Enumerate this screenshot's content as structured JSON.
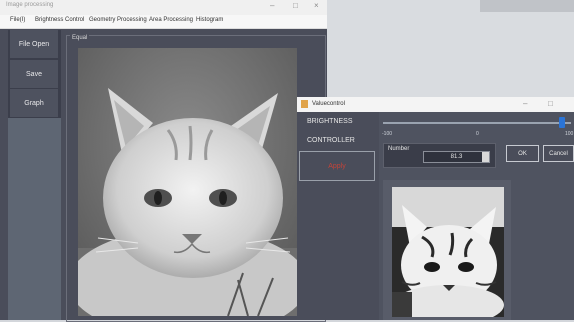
{
  "main_window": {
    "title": "Image processing",
    "menu": [
      "File(I)",
      "Brightness Control",
      "Geometry Processing",
      "Area Processing",
      "Histogram"
    ],
    "sidebar": [
      "File Open",
      "Save",
      "Graph"
    ],
    "frame_label": "Equal"
  },
  "value_control": {
    "title": "Valuecontrol",
    "left_label_1": "BRIGHTNESS",
    "left_label_2": "CONTROLLER",
    "apply_label": "Apply",
    "slider": {
      "min_label": "-100",
      "mid_label": "0",
      "max_label": "100",
      "value_fraction": 0.95
    },
    "number_label": "Number",
    "number_value": "81.3",
    "ok_label": "OK",
    "cancel_label": "Cancel"
  }
}
